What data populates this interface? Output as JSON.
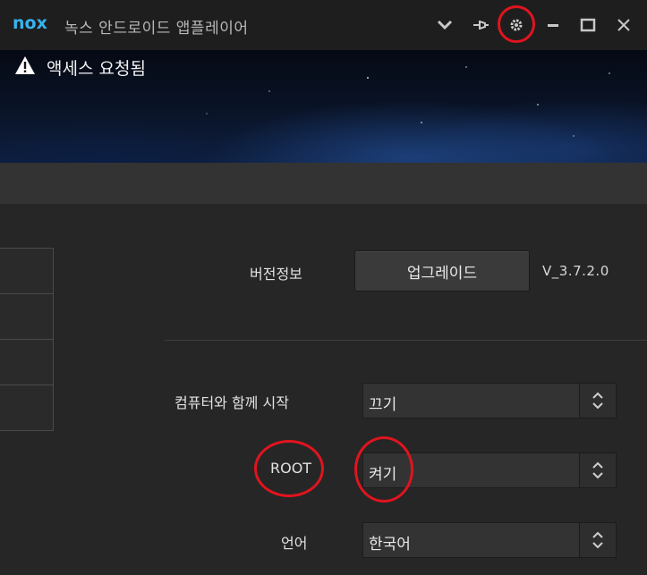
{
  "window": {
    "title": "녹스 안드로이드 앱플레이어",
    "logo_text": "nox",
    "icons": [
      "chevron-down-icon",
      "pin-icon",
      "gear-icon",
      "minimize-icon",
      "maximize-icon",
      "close-icon"
    ]
  },
  "banner": {
    "notice": "액세스 요청됨",
    "icon": "warning-icon"
  },
  "settings": {
    "version_label": "버전정보",
    "upgrade_button": "업그레이드",
    "version": "V_3.7.2.0",
    "startup_label": "컴퓨터와 함께 시작",
    "startup_value": "끄기",
    "root_label": "ROOT",
    "root_value": "켜기",
    "language_label": "언어",
    "language_value": "한국어"
  },
  "annotations": {
    "highlight_color": "#e0141e"
  }
}
